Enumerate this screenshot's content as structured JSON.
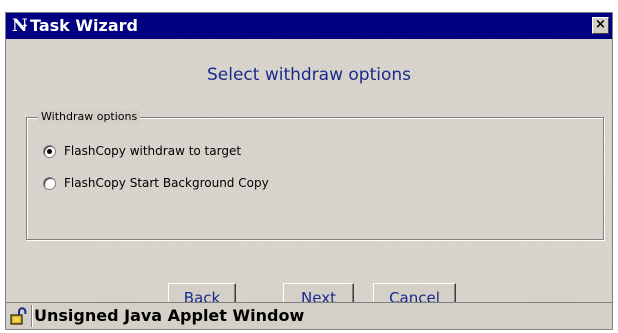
{
  "window": {
    "title": "Task Wizard",
    "app_icon_letter": "N",
    "close_label": "×"
  },
  "wizard": {
    "heading": "Select withdraw options",
    "group_title": "Withdraw options",
    "options": [
      {
        "label": "FlashCopy withdraw to target",
        "selected": true
      },
      {
        "label": "FlashCopy Start Background Copy",
        "selected": false
      }
    ]
  },
  "buttons": {
    "back": "Back",
    "next": "Next",
    "cancel": "Cancel"
  },
  "statusbar": {
    "text": "Unsigned Java Applet Window",
    "icon": "unlocked-padlock-icon"
  },
  "colors": {
    "titlebar": "#000080",
    "accent_text": "#1a2a8c",
    "face": "#d4d0c8"
  }
}
